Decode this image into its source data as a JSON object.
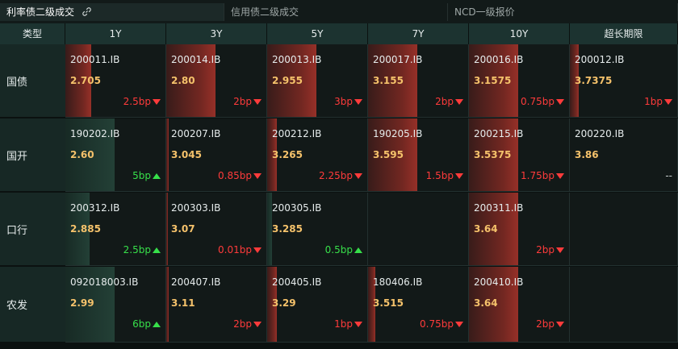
{
  "tabs": [
    {
      "label": "利率债二级成交",
      "active": true
    },
    {
      "label": "信用债二级成交",
      "active": false
    },
    {
      "label": "NCD一级报价",
      "active": false
    }
  ],
  "columns": [
    "类型",
    "1Y",
    "3Y",
    "5Y",
    "7Y",
    "10Y",
    "超长期限"
  ],
  "rows": [
    {
      "label": "国债",
      "cells": [
        {
          "code": "200011.IB",
          "yield": "2.705",
          "change": "2.5bp",
          "dir": "up",
          "level": 0.52
        },
        {
          "code": "200014.IB",
          "yield": "2.80",
          "change": "2bp",
          "dir": "up",
          "level": 0.98
        },
        {
          "code": "200013.IB",
          "yield": "2.955",
          "change": "3bp",
          "dir": "up",
          "level": 0.98
        },
        {
          "code": "200017.IB",
          "yield": "3.155",
          "change": "2bp",
          "dir": "up",
          "level": 0.98
        },
        {
          "code": "200016.IB",
          "yield": "3.1575",
          "change": "0.75bp",
          "dir": "up",
          "level": 0.98
        },
        {
          "code": "200012.IB",
          "yield": "3.7375",
          "change": "1bp",
          "dir": "up",
          "level": 0.18
        }
      ]
    },
    {
      "label": "国开",
      "cells": [
        {
          "code": "190202.IB",
          "yield": "2.60",
          "change": "5bp",
          "dir": "down",
          "level": 0.98
        },
        {
          "code": "200207.IB",
          "yield": "3.045",
          "change": "0.85bp",
          "dir": "up",
          "level": 0.05
        },
        {
          "code": "200212.IB",
          "yield": "3.265",
          "change": "2.25bp",
          "dir": "up",
          "level": 0.2
        },
        {
          "code": "190205.IB",
          "yield": "3.595",
          "change": "1.5bp",
          "dir": "up",
          "level": 0.98
        },
        {
          "code": "200215.IB",
          "yield": "3.5375",
          "change": "1.75bp",
          "dir": "up",
          "level": 0.98
        },
        {
          "code": "200220.IB",
          "yield": "3.86",
          "change": "--",
          "dir": "flat",
          "level": 0
        }
      ]
    },
    {
      "label": "口行",
      "cells": [
        {
          "code": "200312.IB",
          "yield": "2.885",
          "change": "2.5bp",
          "dir": "down",
          "level": 0.48
        },
        {
          "code": "200303.IB",
          "yield": "3.07",
          "change": "0.01bp",
          "dir": "up",
          "level": 0.04
        },
        {
          "code": "200305.IB",
          "yield": "3.285",
          "change": "0.5bp",
          "dir": "down",
          "level": 0.1
        },
        {
          "code": "",
          "yield": "",
          "change": "",
          "dir": "none",
          "level": 0
        },
        {
          "code": "200311.IB",
          "yield": "3.64",
          "change": "2bp",
          "dir": "up",
          "level": 0.98
        },
        {
          "code": "",
          "yield": "",
          "change": "",
          "dir": "none",
          "level": 0
        }
      ]
    },
    {
      "label": "农发",
      "cells": [
        {
          "code": "092018003.IB",
          "yield": "2.99",
          "change": "6bp",
          "dir": "down",
          "level": 0.98
        },
        {
          "code": "200407.IB",
          "yield": "3.11",
          "change": "2bp",
          "dir": "up",
          "level": 0.05
        },
        {
          "code": "200405.IB",
          "yield": "3.29",
          "change": "1bp",
          "dir": "up",
          "level": 0.2
        },
        {
          "code": "180406.IB",
          "yield": "3.515",
          "change": "0.75bp",
          "dir": "up",
          "level": 0.14
        },
        {
          "code": "200410.IB",
          "yield": "3.64",
          "change": "2bp",
          "dir": "up",
          "level": 0.98
        },
        {
          "code": "",
          "yield": "",
          "change": "",
          "dir": "none",
          "level": 0
        }
      ]
    }
  ],
  "colors": {
    "up": "#ff3b3b",
    "down": "#37e04a",
    "yield": "#f5c26b",
    "header_bg": "#1c3330"
  },
  "icons": {
    "tab_link": "link-icon"
  }
}
